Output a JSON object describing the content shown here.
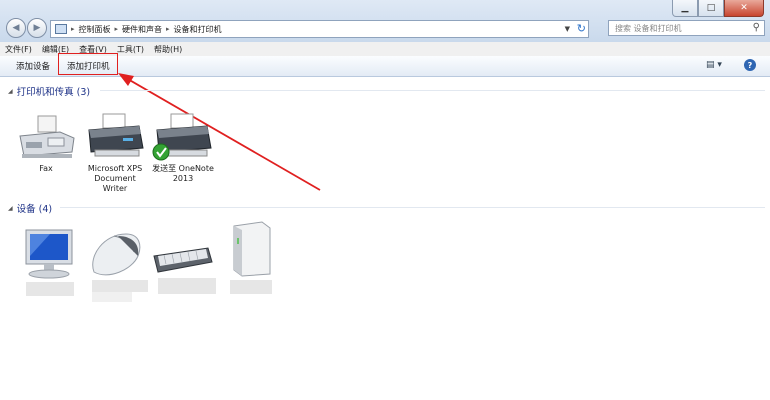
{
  "window": {
    "minimize_icon": "minimize-icon",
    "maximize_icon": "maximize-icon",
    "close_icon": "close-icon"
  },
  "address_bar": {
    "crumbs": [
      "控制面板",
      "硬件和声音",
      "设备和打印机"
    ]
  },
  "search": {
    "placeholder": "搜索 设备和打印机"
  },
  "menu": [
    "文件(F)",
    "编辑(E)",
    "查看(V)",
    "工具(T)",
    "帮助(H)"
  ],
  "commands": {
    "add_device": "添加设备",
    "add_printer": "添加打印机"
  },
  "printers_group": {
    "title": "打印机和传真 (3)",
    "items": [
      {
        "label": "Fax",
        "icon": "fax-icon"
      },
      {
        "label": "Microsoft XPS Document Writer",
        "icon": "printer-icon"
      },
      {
        "label": "发送至 OneNote 2013",
        "icon": "printer-default-icon"
      }
    ]
  },
  "devices_group": {
    "title": "设备 (4)",
    "items": [
      {
        "icon": "monitor-icon"
      },
      {
        "icon": "mouse-icon"
      },
      {
        "icon": "keyboard-icon"
      },
      {
        "icon": "external-drive-icon"
      }
    ]
  },
  "colors": {
    "accent": "#1e3287",
    "highlight": "#e02020"
  }
}
